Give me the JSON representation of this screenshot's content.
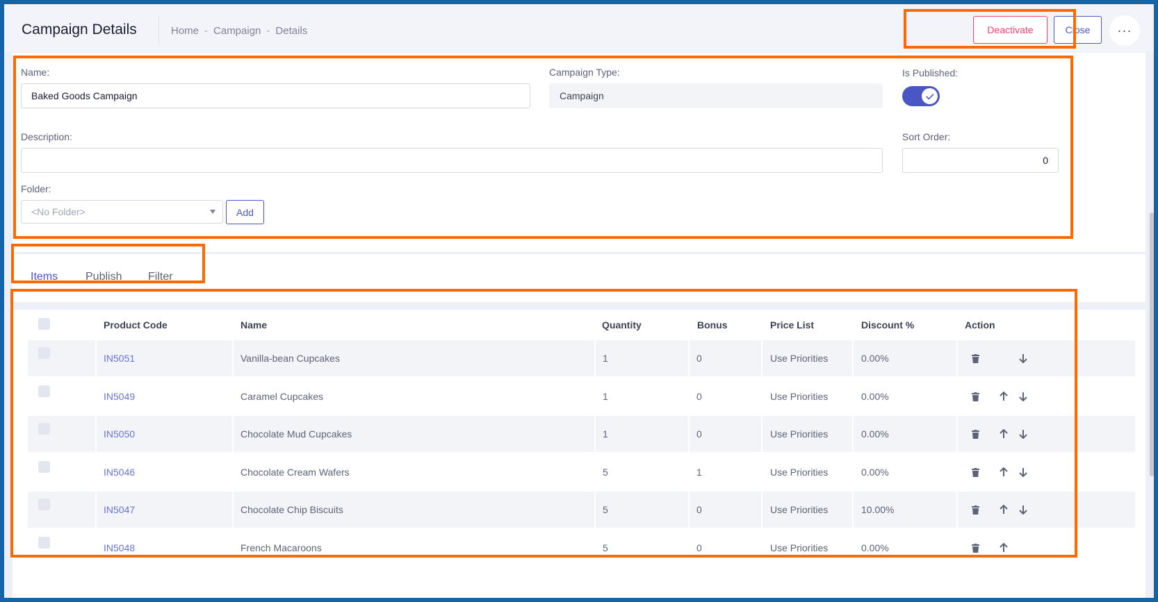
{
  "header": {
    "title": "Campaign Details",
    "breadcrumb": [
      "Home",
      "Campaign",
      "Details"
    ],
    "breadcrumb_sep": "-",
    "deactivate_label": "Deactivate",
    "close_label": "Close",
    "more_label": "···"
  },
  "form": {
    "name_label": "Name:",
    "name_value": "Baked Goods Campaign",
    "campaign_type_label": "Campaign Type:",
    "campaign_type_value": "Campaign",
    "is_published_label": "Is Published:",
    "is_published": true,
    "description_label": "Description:",
    "description_value": "",
    "sort_order_label": "Sort Order:",
    "sort_order_value": "0",
    "folder_label": "Folder:",
    "folder_value": "<No Folder>",
    "add_label": "Add"
  },
  "tabs": [
    {
      "label": "Items",
      "active": true
    },
    {
      "label": "Publish",
      "active": false
    },
    {
      "label": "Filter",
      "active": false
    }
  ],
  "table": {
    "columns": [
      "Product Code",
      "Name",
      "Quantity",
      "Bonus",
      "Price List",
      "Discount %",
      "Action"
    ],
    "rows": [
      {
        "code": "IN5051",
        "name": "Vanilla-bean Cupcakes",
        "quantity": "1",
        "bonus": "0",
        "price_list": "Use Priorities",
        "discount": "0.00%",
        "up": false,
        "down": true
      },
      {
        "code": "IN5049",
        "name": "Caramel Cupcakes",
        "quantity": "1",
        "bonus": "0",
        "price_list": "Use Priorities",
        "discount": "0.00%",
        "up": true,
        "down": true
      },
      {
        "code": "IN5050",
        "name": "Chocolate Mud Cupcakes",
        "quantity": "1",
        "bonus": "0",
        "price_list": "Use Priorities",
        "discount": "0.00%",
        "up": true,
        "down": true
      },
      {
        "code": "IN5046",
        "name": "Chocolate Cream Wafers",
        "quantity": "5",
        "bonus": "1",
        "price_list": "Use Priorities",
        "discount": "0.00%",
        "up": true,
        "down": true
      },
      {
        "code": "IN5047",
        "name": "Chocolate Chip Biscuits",
        "quantity": "5",
        "bonus": "0",
        "price_list": "Use Priorities",
        "discount": "10.00%",
        "up": true,
        "down": true
      },
      {
        "code": "IN5048",
        "name": "French Macaroons",
        "quantity": "5",
        "bonus": "0",
        "price_list": "Use Priorities",
        "discount": "0.00%",
        "up": true,
        "down": false
      }
    ]
  },
  "colors": {
    "accent": "#4a56c4",
    "danger": "#f1416c",
    "highlight": "#ff6a00",
    "border": "#1565a6"
  },
  "icons": {
    "trash": "trash-icon",
    "up": "arrow-up-icon",
    "down": "arrow-down-icon",
    "check": "check-icon",
    "more": "more-horizontal-icon",
    "caret": "caret-down-icon"
  }
}
